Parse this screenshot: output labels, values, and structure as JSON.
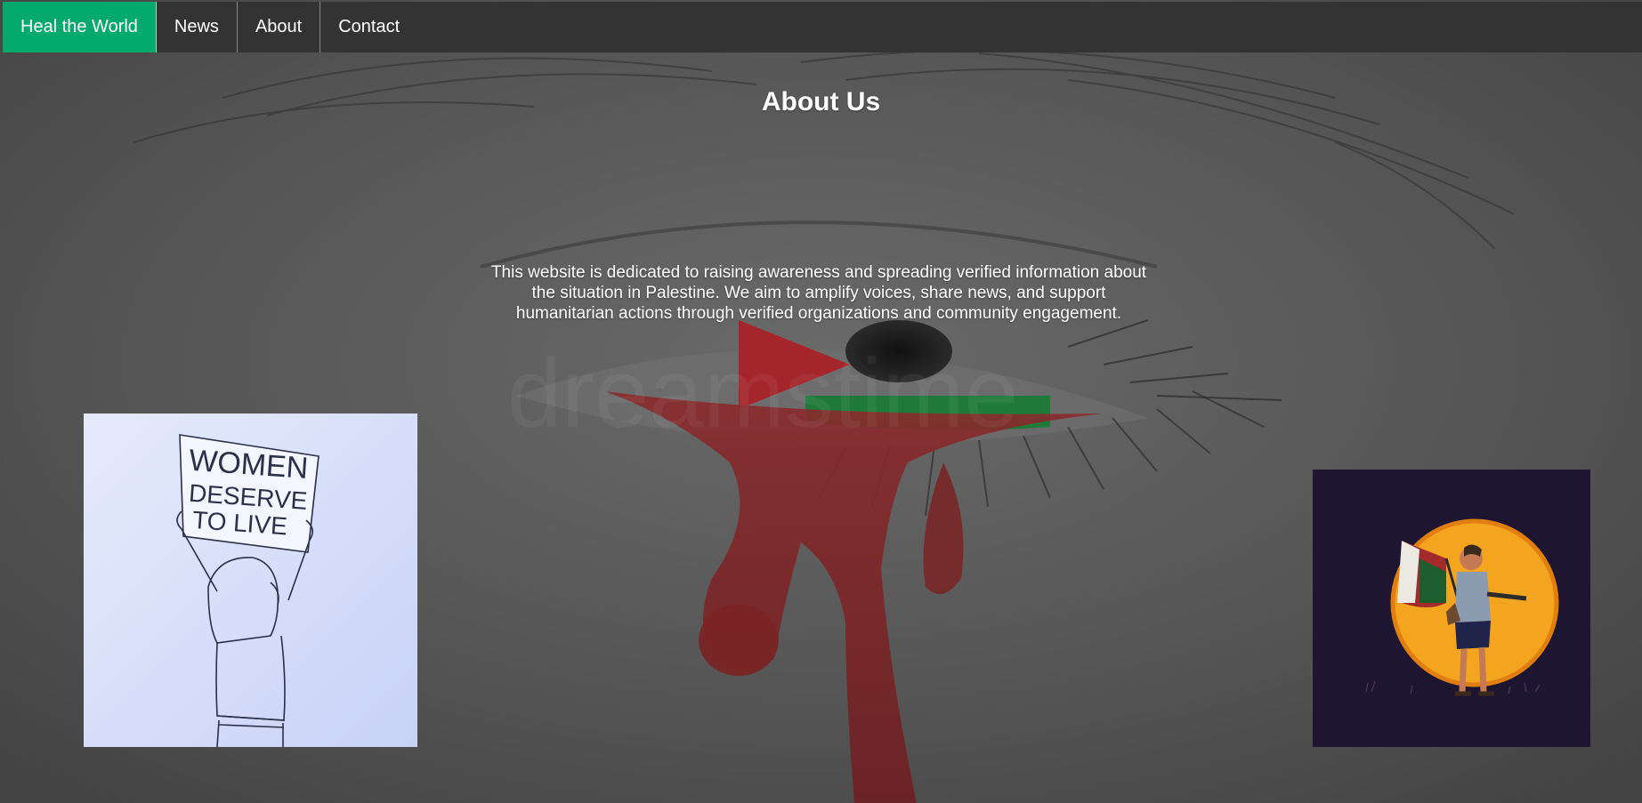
{
  "nav": {
    "items": [
      {
        "label": "Heal the World",
        "active": true
      },
      {
        "label": "News",
        "active": false
      },
      {
        "label": "About",
        "active": false
      },
      {
        "label": "Contact",
        "active": false
      }
    ]
  },
  "main": {
    "title": "About Us",
    "description": "This website is dedicated to raising awareness and spreading verified information about the situation in Palestine. We aim to amplify voices, share news, and support humanitarian actions through verified organizations and community engagement."
  },
  "images": {
    "left": {
      "sign_text": "WOMEN DESERVE TO LIVE"
    },
    "background": {
      "watermark": "dreamstime"
    }
  },
  "colors": {
    "navbar": "#333333",
    "active": "#04AA6D",
    "text": "#ffffff",
    "flag_red": "#b3262b",
    "flag_green": "#1f7a3a"
  }
}
